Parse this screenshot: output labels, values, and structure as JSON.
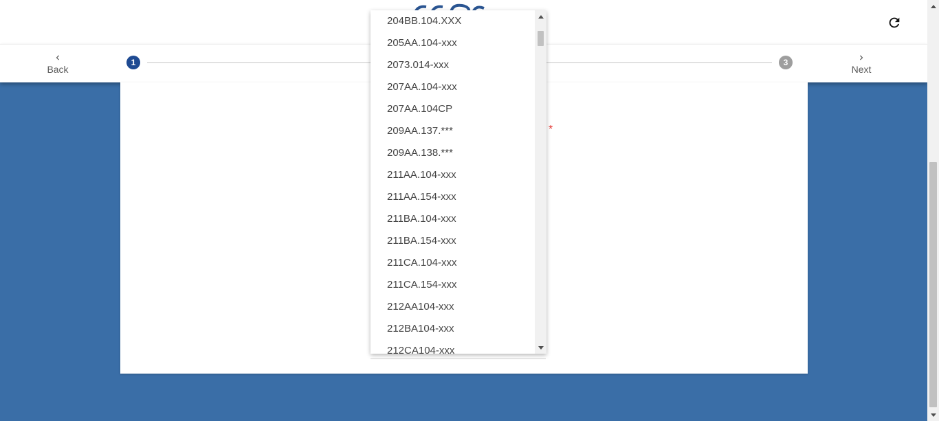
{
  "header": {
    "logo_icon": "brand-logo",
    "refresh_icon": "refresh-icon"
  },
  "stepper": {
    "back_label": "Back",
    "next_label": "Next",
    "steps": [
      {
        "number": "1",
        "state": "active",
        "color": "#1e4a92"
      },
      {
        "number": "3",
        "state": "inactive",
        "color": "#9e9e9e"
      }
    ]
  },
  "form": {
    "required_marker": "*"
  },
  "dropdown": {
    "options": [
      "204BB.104.XXX",
      "205AA.104-xxx",
      "2073.014-xxx",
      "207AA.104-xxx",
      "207AA.104CP",
      "209AA.137.***",
      "209AA.138.***",
      "211AA.104-xxx",
      "211AA.154-xxx",
      "211BA.104-xxx",
      "211BA.154-xxx",
      "211CA.104-xxx",
      "211CA.154-xxx",
      "212AA104-xxx",
      "212BA104-xxx",
      "212CA104-xxx"
    ]
  },
  "colors": {
    "background": "#3a6ea7",
    "accent": "#1e4a92",
    "required": "#e53935"
  }
}
